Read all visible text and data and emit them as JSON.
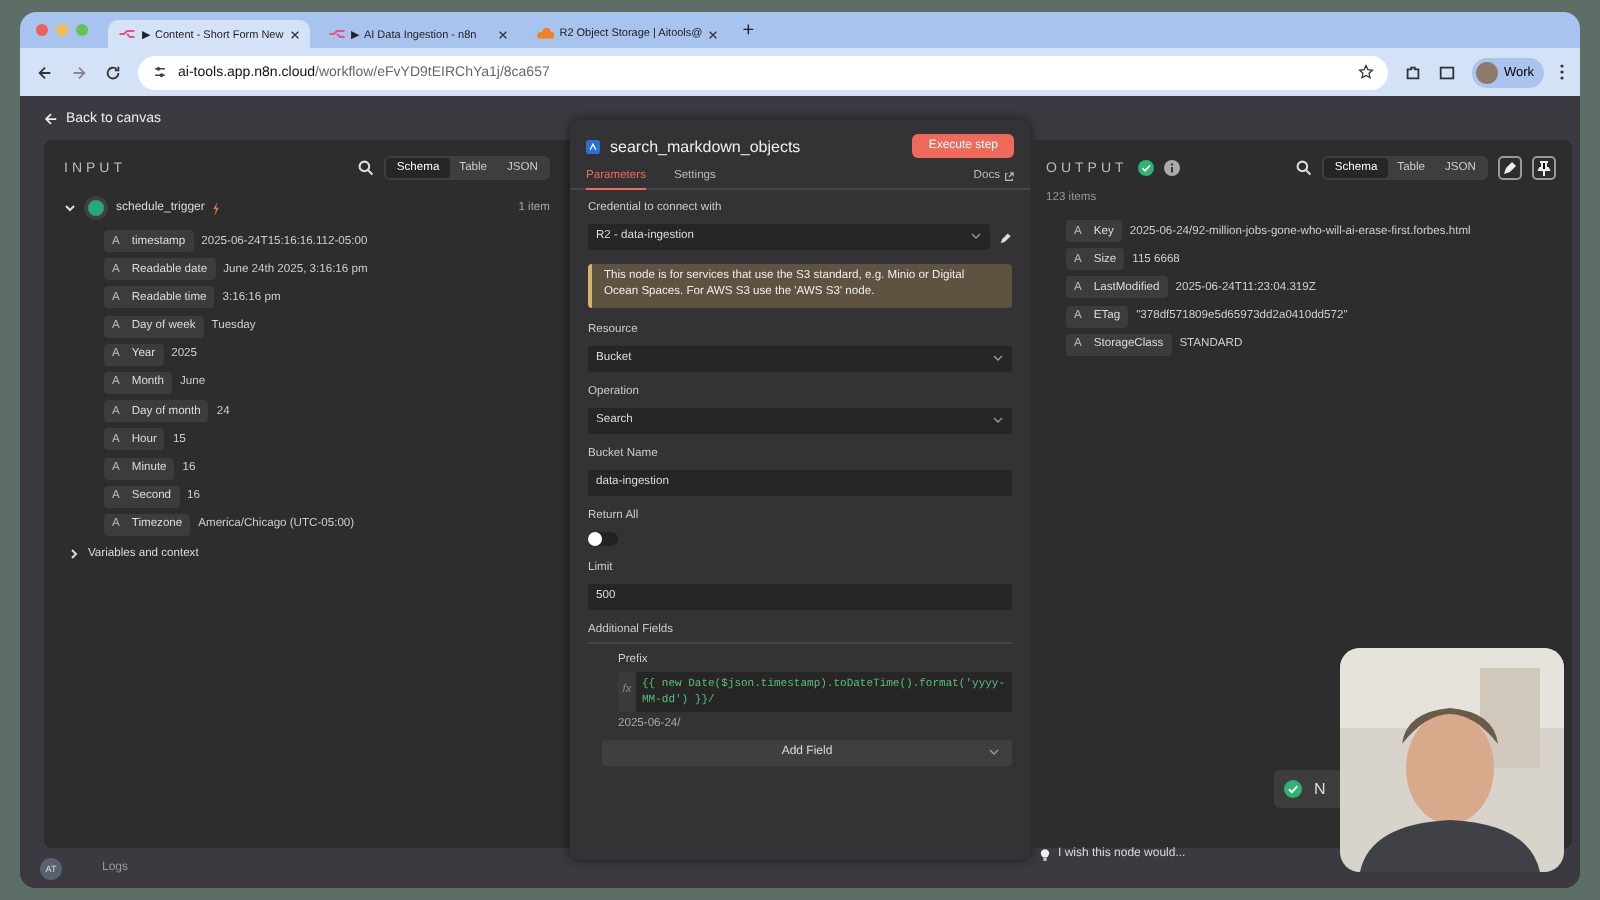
{
  "browser": {
    "tabs": [
      {
        "title": "▶ Content - Short Form New",
        "selected": true,
        "kind": "n8n"
      },
      {
        "title": "▶ AI Data Ingestion - n8n",
        "selected": false,
        "kind": "n8n"
      },
      {
        "title": "R2 Object Storage | Aitools@",
        "selected": false,
        "kind": "cloud"
      }
    ],
    "new_tab": "+",
    "url_host": "ai-tools.app.n8n.cloud",
    "url_path": "/workflow/eFvYD9tEIRChYa1j/8ca657",
    "profile": "Work"
  },
  "back": "Back to canvas",
  "input": {
    "title": "INPUT",
    "views": [
      {
        "label": "Schema",
        "selected": true
      },
      {
        "label": "Table",
        "selected": false
      },
      {
        "label": "JSON",
        "selected": false
      }
    ],
    "node": {
      "name": "schedule_trigger",
      "count": "1 item",
      "expanded": true
    },
    "fields": [
      {
        "type": "A",
        "name": "timestamp",
        "value": "2025-06-24T15:16:16.112-05:00"
      },
      {
        "type": "A",
        "name": "Readable date",
        "value": "June 24th 2025, 3:16:16 pm"
      },
      {
        "type": "A",
        "name": "Readable time",
        "value": "3:16:16 pm"
      },
      {
        "type": "A",
        "name": "Day of week",
        "value": "Tuesday"
      },
      {
        "type": "A",
        "name": "Year",
        "value": "2025"
      },
      {
        "type": "A",
        "name": "Month",
        "value": "June"
      },
      {
        "type": "A",
        "name": "Day of month",
        "value": "24"
      },
      {
        "type": "A",
        "name": "Hour",
        "value": "15"
      },
      {
        "type": "A",
        "name": "Minute",
        "value": "16"
      },
      {
        "type": "A",
        "name": "Second",
        "value": "16"
      },
      {
        "type": "A",
        "name": "Timezone",
        "value": "America/Chicago (UTC-05:00)"
      }
    ],
    "variables": {
      "label": "Variables and context",
      "expanded": false
    }
  },
  "editor": {
    "title": "search_markdown_objects",
    "execute": "Execute step",
    "tabs": [
      {
        "label": "Parameters",
        "selected": true
      },
      {
        "label": "Settings",
        "selected": false
      }
    ],
    "docs": "Docs",
    "credential": {
      "label": "Credential to connect with",
      "value": "R2 - data-ingestion"
    },
    "notice": "This node is for services that use the S3 standard, e.g. Minio or Digital Ocean Spaces. For AWS S3 use the 'AWS S3' node.",
    "params": [
      {
        "kind": "select",
        "label": "Resource",
        "value": "Bucket"
      },
      {
        "kind": "select",
        "label": "Operation",
        "value": "Search"
      },
      {
        "kind": "input",
        "label": "Bucket Name",
        "value": "data-ingestion"
      },
      {
        "kind": "toggle",
        "label": "Return All",
        "on": false
      },
      {
        "kind": "input",
        "label": "Limit",
        "value": "500"
      }
    ],
    "additional": {
      "label": "Additional Fields",
      "prefix_label": "Prefix",
      "fx": "fx",
      "expression": "{{ new Date($json.timestamp).toDateTime().format('yyyy-MM-dd') }}/",
      "preview": "2025-06-24/",
      "add_field": "Add Field"
    }
  },
  "output": {
    "title": "OUTPUT",
    "count": "123 items",
    "views": [
      {
        "label": "Schema",
        "selected": true
      },
      {
        "label": "Table",
        "selected": false
      },
      {
        "label": "JSON",
        "selected": false
      }
    ],
    "fields": [
      {
        "type": "A",
        "name": "Key",
        "value": "2025-06-24/92-million-jobs-gone-who-will-ai-erase-first.forbes.html"
      },
      {
        "type": "A",
        "name": "Size",
        "value": "115 6668"
      },
      {
        "type": "A",
        "name": "LastModified",
        "value": "2025-06-24T11:23:04.319Z"
      },
      {
        "type": "A",
        "name": "ETag",
        "value": "\"378df571809e5d65973dd2a0410dd572\""
      },
      {
        "type": "A",
        "name": "StorageClass",
        "value": "STANDARD"
      }
    ]
  },
  "footer": {
    "avatar": "AT",
    "logs": "Logs",
    "feedback": "I wish this node would...",
    "toast": "N"
  }
}
